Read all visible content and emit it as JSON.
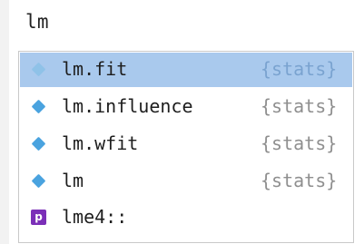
{
  "editor": {
    "typed_text": "lm"
  },
  "completions": {
    "items": [
      {
        "name": "lm.fit",
        "source": "{stats}",
        "icon": "function-icon",
        "selected": true
      },
      {
        "name": "lm.influence",
        "source": "{stats}",
        "icon": "function-icon",
        "selected": false
      },
      {
        "name": "lm.wfit",
        "source": "{stats}",
        "icon": "function-icon",
        "selected": false
      },
      {
        "name": "lm",
        "source": "{stats}",
        "icon": "function-icon",
        "selected": false
      },
      {
        "name": "lme4::",
        "source": "",
        "icon": "package-icon",
        "icon_glyph": "p",
        "selected": false
      }
    ]
  },
  "colors": {
    "selection": "#a9c9ed",
    "function_icon": "#4aa3df",
    "package_icon": "#7b2fb8",
    "source_text": "#8f8f8f"
  }
}
